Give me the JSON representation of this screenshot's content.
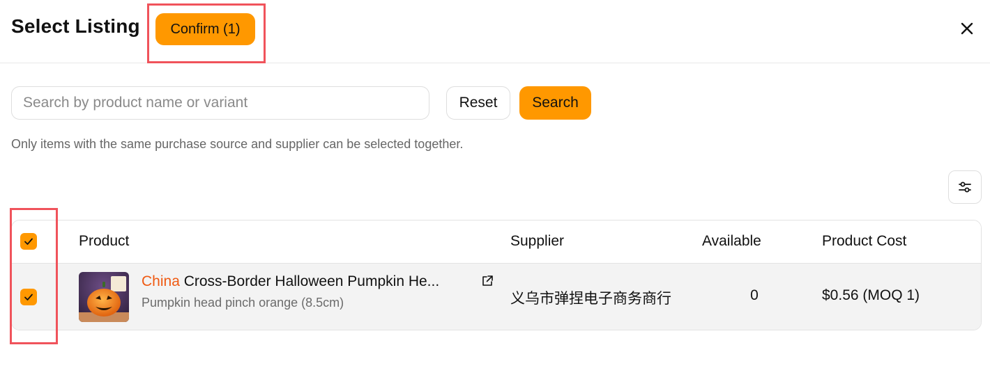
{
  "header": {
    "title": "Select Listing",
    "confirm_label": "Confirm (1)"
  },
  "search": {
    "placeholder": "Search by product name or variant",
    "value": "",
    "reset_label": "Reset",
    "search_label": "Search"
  },
  "note": "Only items with the same purchase source and supplier can be selected together.",
  "table": {
    "columns": [
      "Product",
      "Supplier",
      "Available",
      "Product Cost"
    ],
    "select_all_checked": true,
    "rows": [
      {
        "checked": true,
        "origin": "China",
        "title": " Cross-Border Halloween Pumpkin He...",
        "variant": "Pumpkin head pinch orange (8.5cm)",
        "supplier": "义乌市弹捏电子商务商行",
        "available": "0",
        "cost": "$0.56 (MOQ 1)"
      }
    ]
  },
  "colors": {
    "accent": "#ff9800",
    "highlight": "#f0535b",
    "origin_text": "#ef5a12"
  },
  "icons": {
    "close": "close-icon",
    "filter": "sliders-icon",
    "external_link": "external-link-icon",
    "checkbox": "check-icon"
  }
}
